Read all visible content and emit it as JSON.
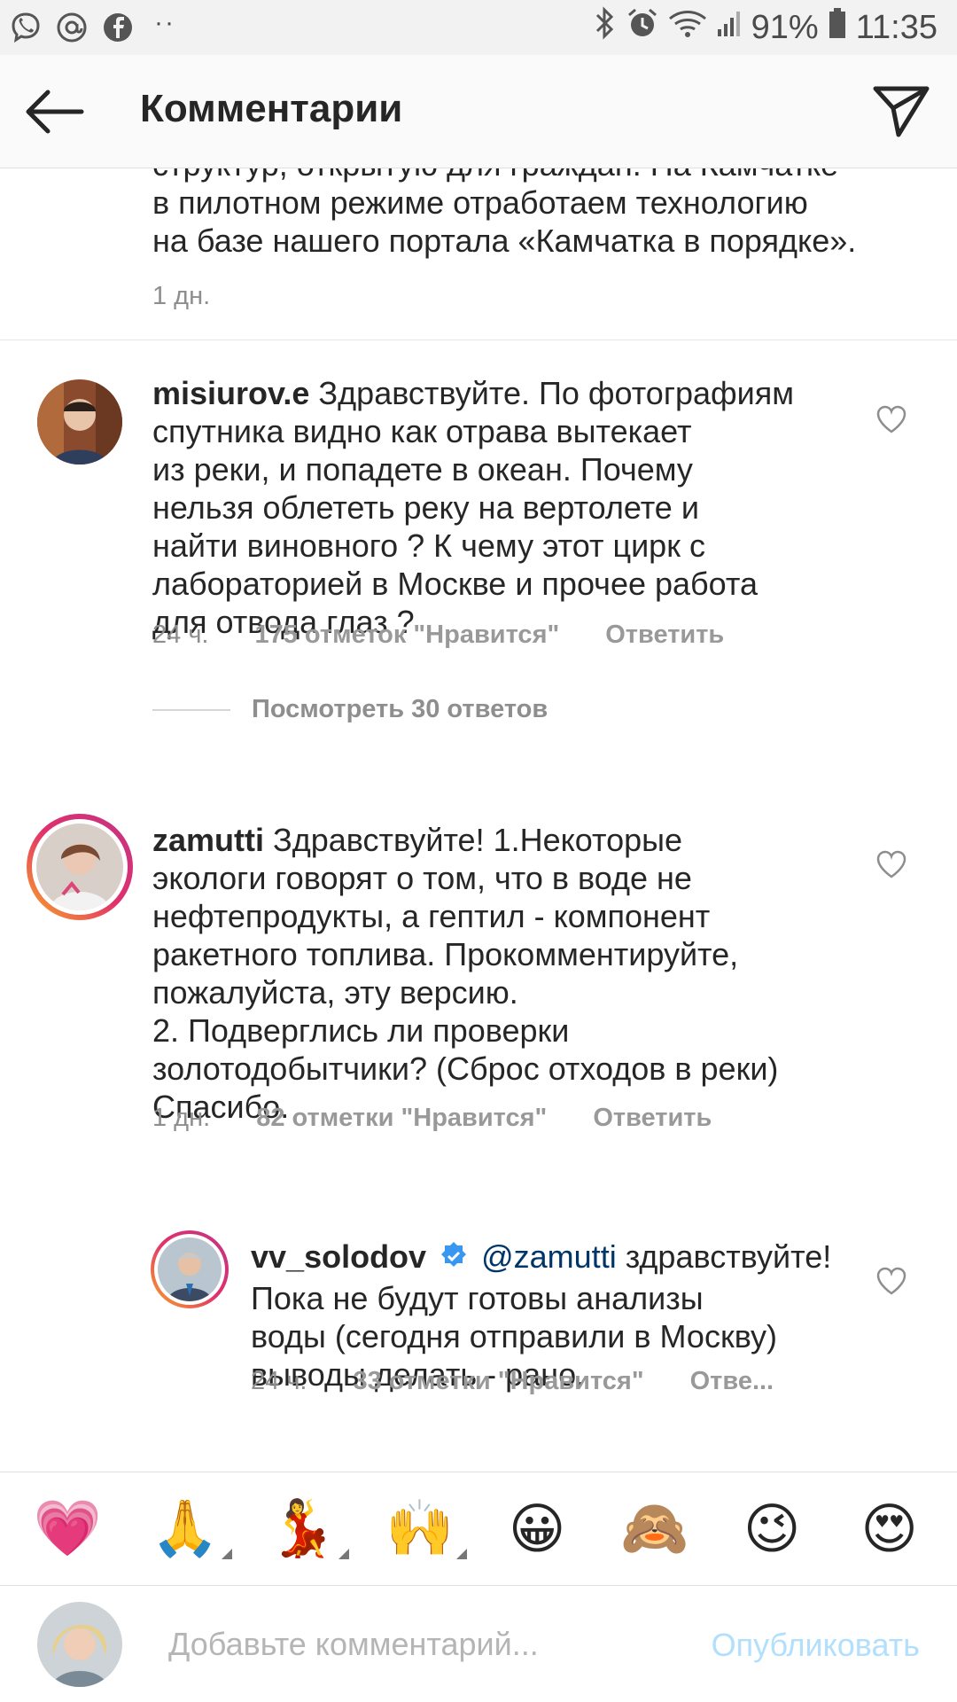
{
  "status_bar": {
    "icons_left": [
      "viber-icon",
      "at-icon",
      "facebook-icon",
      "more-dots-icon"
    ],
    "battery": "91%",
    "time": "11:35"
  },
  "header": {
    "title": "Комментарии"
  },
  "clipped_comment": {
    "partial_first_line": "структур, открытую для граждан. На Камчатке",
    "text": "в пилотном режиме отработаем технологию\nна базе нашего портала «Камчатка в порядке».",
    "time": "1 дн."
  },
  "comments": [
    {
      "username": "misiurov.e",
      "body": "Здравствуйте. По фотографиям спутника видно как отрава вытекает\nиз реки, и попадете в океан. Почему\nнельзя облететь реку на вертолете и\nнайти виновного ? К чему этот цирк с\nлабораторией в Москве и прочее работа\nдля отвода глаз ?",
      "time": "24 ч.",
      "likes": "175 отметок \"Нравится\"",
      "reply": "Ответить",
      "view_replies": "Посмотреть 30 ответов"
    },
    {
      "username": "zamutti",
      "body": "Здравствуйте! 1.Некоторые\nэкологи говорят о том, что в воде не\nнефтепродукты, а гептил - компонент\nракетного топлива. Прокомментируйте,\nпожалуйста, эту версию.\n2. Подверглись ли проверки\nзолотодобытчики? (Сброс отходов в реки)\nСпасибо.",
      "time": "1 дн.",
      "likes": "82 отметки \"Нравится\"",
      "reply": "Ответить"
    },
    {
      "username": "vv_solodov",
      "verified": true,
      "mention": "@zamutti",
      "body": "здравствуйте!\nПока не будут готовы анализы\nводы (сегодня отправили в Москву)\nвыводы делать - рано.",
      "time": "24 ч.",
      "likes": "33 отметки \"Нравится\"",
      "reply": "Отве..."
    }
  ],
  "emoji_bar": [
    "💗",
    "🙏",
    "💃",
    "🙌",
    "😀",
    "🙈",
    "😉",
    "😍"
  ],
  "comment_input": {
    "placeholder": "Добавьте комментарий...",
    "publish_label": "Опубликовать"
  },
  "colors": {
    "accent_link": "#003569",
    "publish_disabled": "#b2dffc",
    "meta_gray": "#8e8e8e",
    "verified_blue": "#3897f0",
    "story_ring_start": "#f9a825",
    "story_ring_end": "#c13584"
  }
}
